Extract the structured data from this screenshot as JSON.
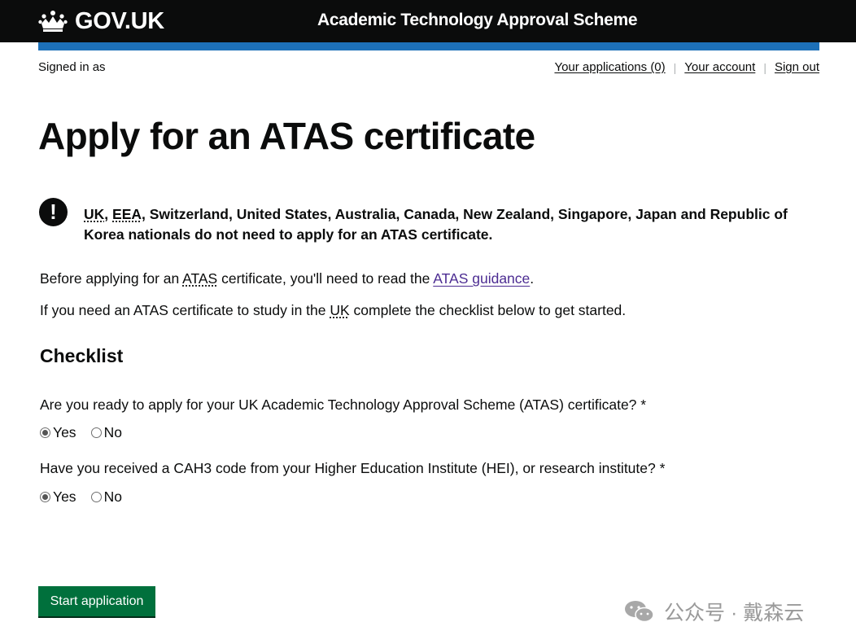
{
  "header": {
    "logo_text": "GOV.UK",
    "service_name": "Academic Technology Approval Scheme"
  },
  "account_bar": {
    "signed_in_text": "Signed in as",
    "nav": {
      "applications": "Your applications (0)",
      "account": "Your account",
      "sign_out": "Sign out"
    }
  },
  "page_title": "Apply for an ATAS certificate",
  "warning": {
    "icon_glyph": "!",
    "abbr_uk": "UK",
    "comma1": ",",
    "abbr_eea": "EEA",
    "text_rest": ", Switzerland, United States, Australia, Canada, New Zealand, Singapore, Japan and Republic of Korea nationals do not need to apply for an ATAS certificate."
  },
  "intro": {
    "p1_prefix": "Before applying for an ",
    "p1_abbr": "ATAS",
    "p1_mid": " certificate, you'll need to read the ",
    "p1_link": "ATAS guidance",
    "p1_suffix": ".",
    "p2_prefix": "If you need an ATAS certificate to study in the ",
    "p2_abbr": "UK",
    "p2_suffix": " complete the checklist below to get started."
  },
  "checklist": {
    "heading": "Checklist",
    "questions": [
      {
        "text": "Are you ready to apply for your UK Academic Technology Approval Scheme (ATAS) certificate? *",
        "options": [
          "Yes",
          "No"
        ],
        "selected": "Yes"
      },
      {
        "text": "Have you received a CAH3 code from your Higher Education Institute (HEI), or research institute? *",
        "options": [
          "Yes",
          "No"
        ],
        "selected": "Yes"
      }
    ]
  },
  "start_button": "Start application",
  "watermark": {
    "text": "公众号 · 戴森云",
    "icon": "wechat-icon"
  },
  "colors": {
    "header_bg": "#0b0c0c",
    "blue_bar": "#1d70b8",
    "button_green": "#00703c",
    "visited_link": "#4c2c92"
  }
}
